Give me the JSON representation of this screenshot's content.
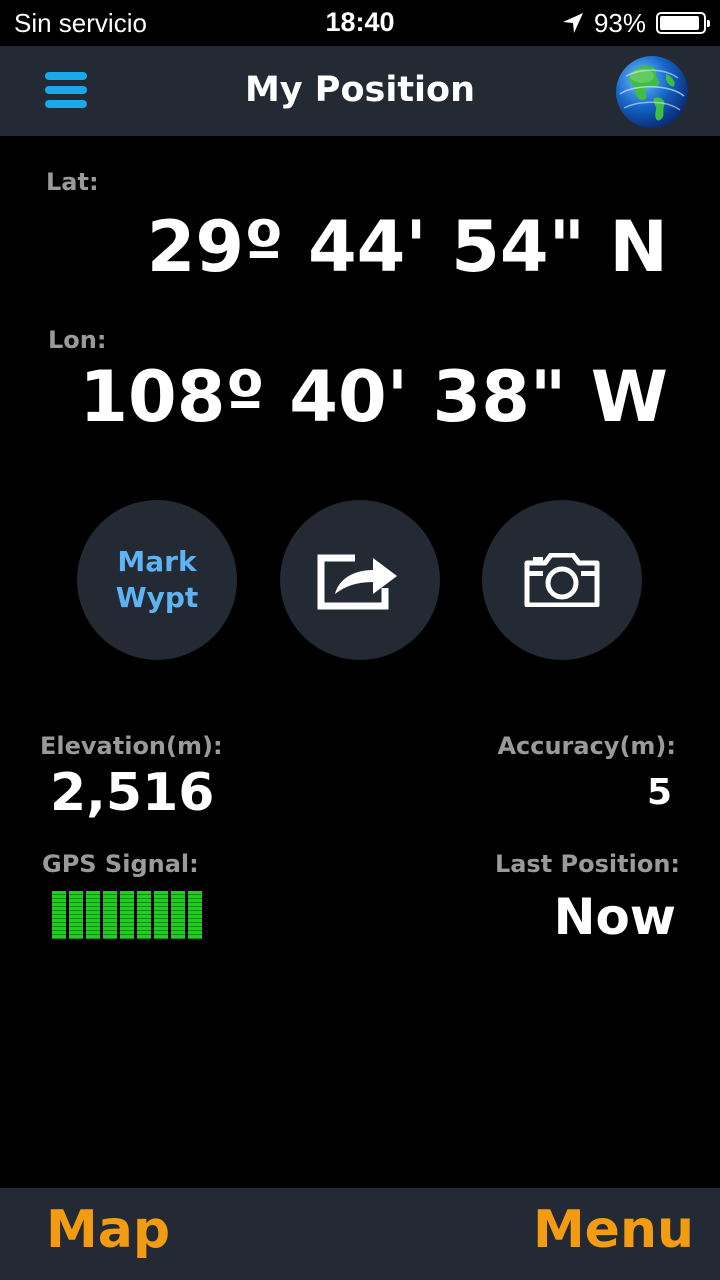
{
  "status_bar": {
    "carrier": "Sin servicio",
    "time": "18:40",
    "battery_percent": "93%",
    "battery_level": 0.93
  },
  "nav": {
    "title": "My Position"
  },
  "position": {
    "lat_label": "Lat:",
    "lat_value": "29º 44' 54\" N",
    "lon_label": "Lon:",
    "lon_value": "108º 40' 38\" W"
  },
  "actions": {
    "mark_waypoint_label": "Mark\nWypt"
  },
  "info": {
    "elevation_label": "Elevation(m):",
    "elevation_value": "2,516",
    "accuracy_label": "Accuracy(m):",
    "accuracy_value": "5",
    "gps_signal_label": "GPS Signal:",
    "gps_signal_bars": 9,
    "gps_signal_max": 9,
    "last_position_label": "Last Position:",
    "last_position_value": "Now"
  },
  "bottom_bar": {
    "map_label": "Map",
    "menu_label": "Menu"
  },
  "colors": {
    "bar_background": "#232a33",
    "accent_blue": "#1aa7ec",
    "mark_text": "#5eb3f2",
    "bottom_accent": "#f39c12",
    "signal_green": "#19d219"
  }
}
